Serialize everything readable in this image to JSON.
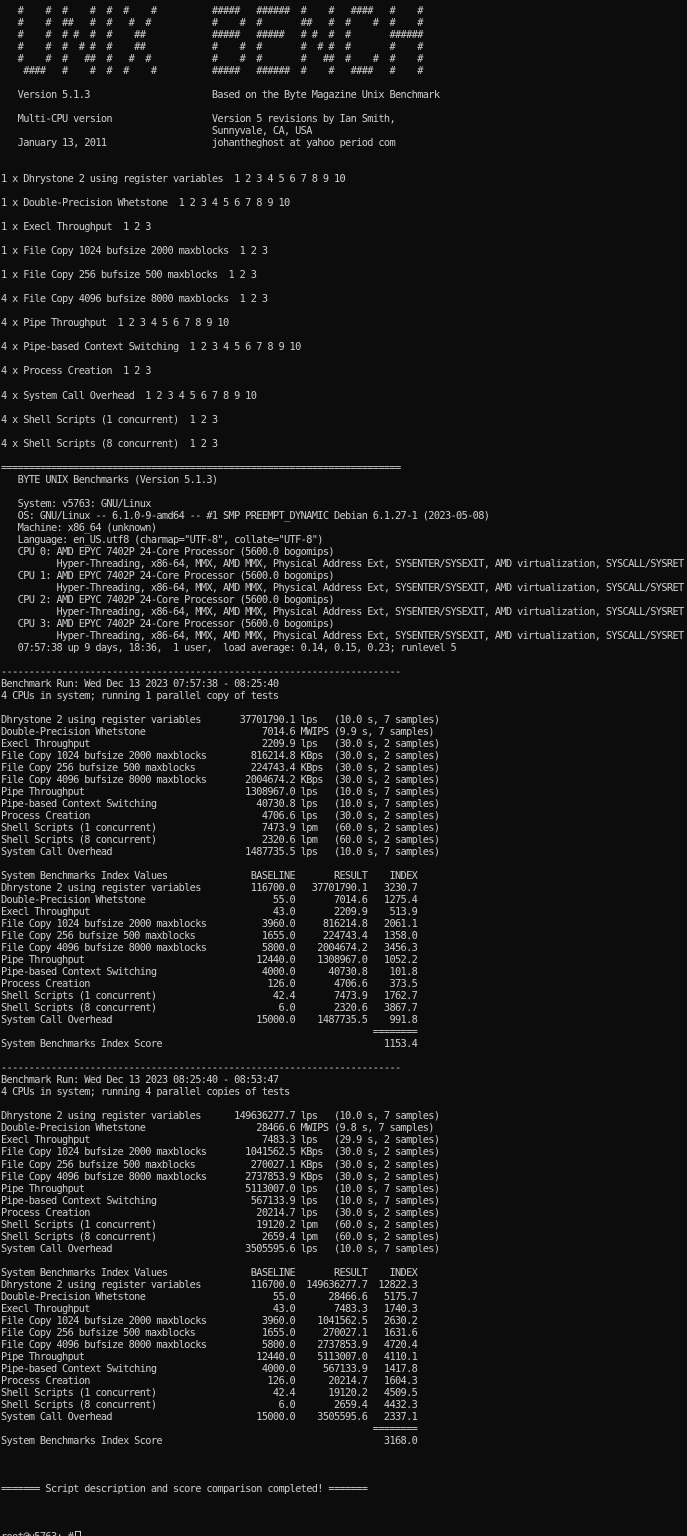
{
  "terminal": {
    "lines": [
      "   #    #  #    #  #  #    #          #####   ######  #    #   ####   #    #",
      "   #    #  ##   #  #   #  #           #    #  #       ##   #  #    #  #    #",
      "   #    #  # #  #  #    ##            #####   #####   # #  #  #       ######",
      "   #    #  #  # #  #    ##            #    #  #       #  # #  #       #    #",
      "   #    #  #   ##  #   #  #           #    #  #       #   ##  #    #  #    #",
      "    ####   #    #  #  #    #          #####   ######  #    #   ####   #    #",
      "",
      "   Version 5.1.3                      Based on the Byte Magazine Unix Benchmark",
      "",
      "   Multi-CPU version                  Version 5 revisions by Ian Smith,",
      "                                      Sunnyvale, CA, USA",
      "   January 13, 2011                   johantheghost at yahoo period com",
      "",
      "",
      "1 x Dhrystone 2 using register variables  1 2 3 4 5 6 7 8 9 10",
      "",
      "1 x Double-Precision Whetstone  1 2 3 4 5 6 7 8 9 10",
      "",
      "1 x Execl Throughput  1 2 3",
      "",
      "1 x File Copy 1024 bufsize 2000 maxblocks  1 2 3",
      "",
      "1 x File Copy 256 bufsize 500 maxblocks  1 2 3",
      "",
      "4 x File Copy 4096 bufsize 8000 maxblocks  1 2 3",
      "",
      "4 x Pipe Throughput  1 2 3 4 5 6 7 8 9 10",
      "",
      "4 x Pipe-based Context Switching  1 2 3 4 5 6 7 8 9 10",
      "",
      "4 x Process Creation  1 2 3",
      "",
      "4 x System Call Overhead  1 2 3 4 5 6 7 8 9 10",
      "",
      "4 x Shell Scripts (1 concurrent)  1 2 3",
      "",
      "4 x Shell Scripts (8 concurrent)  1 2 3",
      "",
      "========================================================================",
      "   BYTE UNIX Benchmarks (Version 5.1.3)",
      "",
      "   System: v5763: GNU/Linux",
      "   OS: GNU/Linux -- 6.1.0-9-amd64 -- #1 SMP PREEMPT_DYNAMIC Debian 6.1.27-1 (2023-05-08)",
      "   Machine: x86_64 (unknown)",
      "   Language: en_US.utf8 (charmap=\"UTF-8\", collate=\"UTF-8\")",
      "   CPU 0: AMD EPYC 7402P 24-Core Processor (5600.0 bogomips)",
      "          Hyper-Threading, x86-64, MMX, AMD MMX, Physical Address Ext, SYSENTER/SYSEXIT, AMD virtualization, SYSCALL/SYSRET",
      "   CPU 1: AMD EPYC 7402P 24-Core Processor (5600.0 bogomips)",
      "          Hyper-Threading, x86-64, MMX, AMD MMX, Physical Address Ext, SYSENTER/SYSEXIT, AMD virtualization, SYSCALL/SYSRET",
      "   CPU 2: AMD EPYC 7402P 24-Core Processor (5600.0 bogomips)",
      "          Hyper-Threading, x86-64, MMX, AMD MMX, Physical Address Ext, SYSENTER/SYSEXIT, AMD virtualization, SYSCALL/SYSRET",
      "   CPU 3: AMD EPYC 7402P 24-Core Processor (5600.0 bogomips)",
      "          Hyper-Threading, x86-64, MMX, AMD MMX, Physical Address Ext, SYSENTER/SYSEXIT, AMD virtualization, SYSCALL/SYSRET",
      "   07:57:38 up 9 days, 18:36,  1 user,  load average: 0.14, 0.15, 0.23; runlevel 5",
      "",
      "------------------------------------------------------------------------",
      "Benchmark Run: Wed Dec 13 2023 07:57:38 - 08:25:40",
      "4 CPUs in system; running 1 parallel copy of tests",
      "",
      "Dhrystone 2 using register variables       37701790.1 lps   (10.0 s, 7 samples)",
      "Double-Precision Whetstone                     7014.6 MWIPS (9.9 s, 7 samples)",
      "Execl Throughput                               2209.9 lps   (30.0 s, 2 samples)",
      "File Copy 1024 bufsize 2000 maxblocks        816214.8 KBps  (30.0 s, 2 samples)",
      "File Copy 256 bufsize 500 maxblocks          224743.4 KBps  (30.0 s, 2 samples)",
      "File Copy 4096 bufsize 8000 maxblocks       2004674.2 KBps  (30.0 s, 2 samples)",
      "Pipe Throughput                             1308967.0 lps   (10.0 s, 7 samples)",
      "Pipe-based Context Switching                  40730.8 lps   (10.0 s, 7 samples)",
      "Process Creation                               4706.6 lps   (30.0 s, 2 samples)",
      "Shell Scripts (1 concurrent)                   7473.9 lpm   (60.0 s, 2 samples)",
      "Shell Scripts (8 concurrent)                   2320.6 lpm   (60.0 s, 2 samples)",
      "System Call Overhead                        1487735.5 lps   (10.0 s, 7 samples)",
      "",
      "System Benchmarks Index Values               BASELINE       RESULT    INDEX",
      "Dhrystone 2 using register variables         116700.0   37701790.1   3230.7",
      "Double-Precision Whetstone                       55.0       7014.6   1275.4",
      "Execl Throughput                                 43.0       2209.9    513.9",
      "File Copy 1024 bufsize 2000 maxblocks          3960.0     816214.8   2061.1",
      "File Copy 256 bufsize 500 maxblocks            1655.0     224743.4   1358.0",
      "File Copy 4096 bufsize 8000 maxblocks          5800.0    2004674.2   3456.3",
      "Pipe Throughput                               12440.0    1308967.0   1052.2",
      "Pipe-based Context Switching                   4000.0      40730.8    101.8",
      "Process Creation                                126.0       4706.6    373.5",
      "Shell Scripts (1 concurrent)                     42.4       7473.9   1762.7",
      "Shell Scripts (8 concurrent)                      6.0       2320.6   3867.7",
      "System Call Overhead                          15000.0    1487735.5    991.8",
      "                                                                   ========",
      "System Benchmarks Index Score                                        1153.4",
      "",
      "------------------------------------------------------------------------",
      "Benchmark Run: Wed Dec 13 2023 08:25:40 - 08:53:47",
      "4 CPUs in system; running 4 parallel copies of tests",
      "",
      "Dhrystone 2 using register variables      149636277.7 lps   (10.0 s, 7 samples)",
      "Double-Precision Whetstone                    28466.6 MWIPS (9.8 s, 7 samples)",
      "Execl Throughput                               7483.3 lps   (29.9 s, 2 samples)",
      "File Copy 1024 bufsize 2000 maxblocks       1041562.5 KBps  (30.0 s, 2 samples)",
      "File Copy 256 bufsize 500 maxblocks          270027.1 KBps  (30.0 s, 2 samples)",
      "File Copy 4096 bufsize 8000 maxblocks       2737853.9 KBps  (30.0 s, 2 samples)",
      "Pipe Throughput                             5113007.0 lps   (10.0 s, 7 samples)",
      "Pipe-based Context Switching                 567133.9 lps   (10.0 s, 7 samples)",
      "Process Creation                              20214.7 lps   (30.0 s, 2 samples)",
      "Shell Scripts (1 concurrent)                  19120.2 lpm   (60.0 s, 2 samples)",
      "Shell Scripts (8 concurrent)                   2659.4 lpm   (60.0 s, 2 samples)",
      "System Call Overhead                        3505595.6 lps   (10.0 s, 7 samples)",
      "",
      "System Benchmarks Index Values               BASELINE       RESULT    INDEX",
      "Dhrystone 2 using register variables         116700.0  149636277.7  12822.3",
      "Double-Precision Whetstone                       55.0      28466.6   5175.7",
      "Execl Throughput                                 43.0       7483.3   1740.3",
      "File Copy 1024 bufsize 2000 maxblocks          3960.0    1041562.5   2630.2",
      "File Copy 256 bufsize 500 maxblocks            1655.0     270027.1   1631.6",
      "File Copy 4096 bufsize 8000 maxblocks          5800.0    2737853.9   4720.4",
      "Pipe Throughput                               12440.0    5113007.0   4110.1",
      "Pipe-based Context Switching                   4000.0     567133.9   1417.8",
      "Process Creation                                126.0      20214.7   1604.3",
      "Shell Scripts (1 concurrent)                     42.4      19120.2   4509.5",
      "Shell Scripts (8 concurrent)                      6.0       2659.4   4432.3",
      "System Call Overhead                          15000.0    3505595.6   2337.1",
      "                                                                   ========",
      "System Benchmarks Index Score                                        3168.0",
      "",
      "",
      "",
      "======= Script description and score comparison completed! =======",
      "",
      "",
      ""
    ],
    "prompt": "root@v5763:~#"
  },
  "colors": {
    "background": "#0c0c0c",
    "foreground": "#cccccc"
  }
}
